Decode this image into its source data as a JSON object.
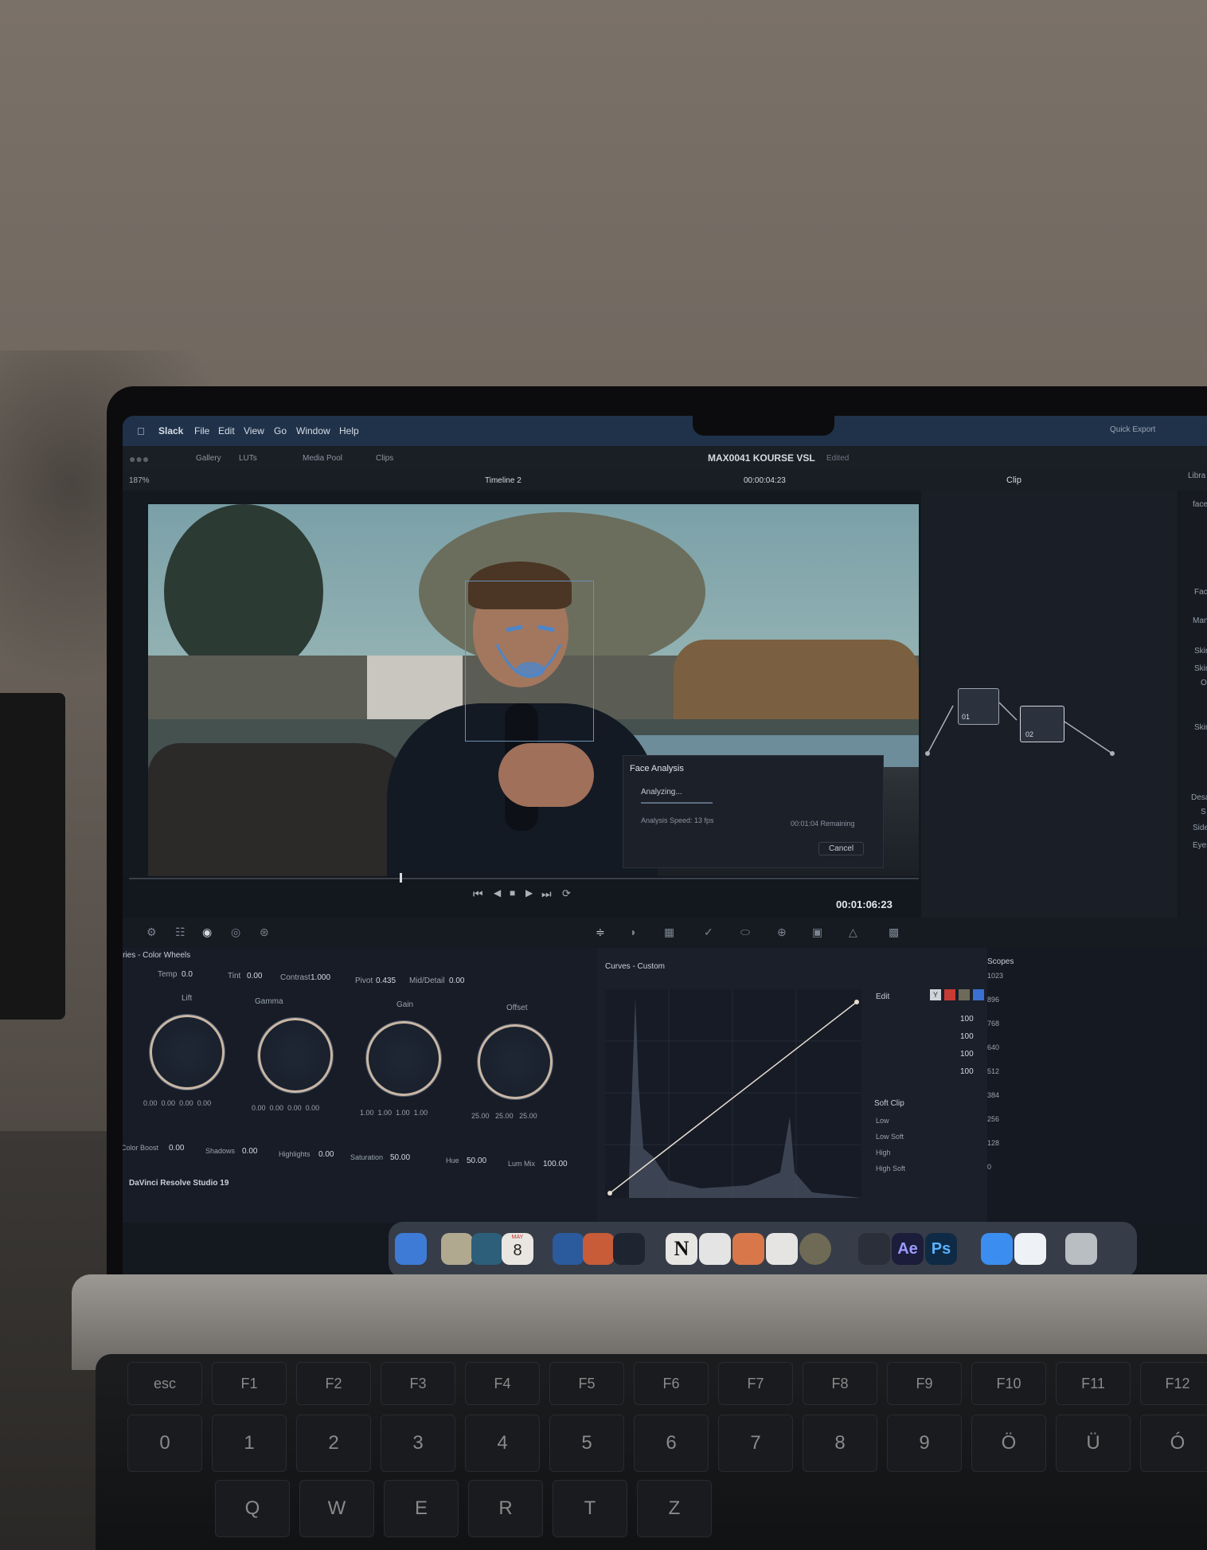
{
  "menubar": {
    "apple_icon": "apple-icon",
    "items": [
      "Slack",
      "File",
      "Edit",
      "View",
      "Go",
      "Window",
      "Help"
    ],
    "quick_export": "Quick Export"
  },
  "titlebar": {
    "tabs": [
      "Gallery",
      "LUTs",
      "Media Pool",
      "Clips"
    ],
    "project": "MAX0041 KOURSE VSL",
    "status": "Edited"
  },
  "viewer_toolbar": {
    "zoom": "187%",
    "timeline": "Timeline 2",
    "timecode": "00:00:04:23",
    "mode": "Clip"
  },
  "right_edge": [
    "Libra",
    "face",
    "Fac",
    "Manu",
    "Skin",
    "Skin",
    "O",
    "Skin",
    "Desat",
    "S",
    "Side",
    "Eyes"
  ],
  "nodes": [
    "01",
    "02"
  ],
  "face_analysis": {
    "title": "Face Analysis",
    "status": "Analyzing...",
    "speed": "Analysis Speed: 13 fps",
    "remaining": "00:01:04 Remaining",
    "cancel": "Cancel"
  },
  "transport": {
    "timecode": "00:01:06:23"
  },
  "primaries": {
    "title": "Primaries - Color Wheels",
    "temp_label": "Temp",
    "temp": "0.0",
    "tint_label": "Tint",
    "tint": "0.00",
    "contrast_label": "Contrast",
    "contrast": "1.000",
    "pivot_label": "Pivot",
    "pivot": "0.435",
    "middetail_label": "Mid/Detail",
    "middetail": "0.00",
    "wheels": [
      {
        "name": "Lift",
        "values": [
          "0.00",
          "0.00",
          "0.00",
          "0.00"
        ]
      },
      {
        "name": "Gamma",
        "values": [
          "0.00",
          "0.00",
          "0.00",
          "0.00"
        ]
      },
      {
        "name": "Gain",
        "values": [
          "1.00",
          "1.00",
          "1.00",
          "1.00"
        ]
      },
      {
        "name": "Offset",
        "values": [
          "25.00",
          "25.00",
          "25.00"
        ]
      }
    ],
    "colorboost_label": "Color Boost",
    "colorboost": "0.00",
    "shadows_label": "Shadows",
    "shadows": "0.00",
    "highlights_label": "Highlights",
    "highlights": "0.00",
    "saturation_label": "Saturation",
    "saturation": "50.00",
    "hue_label": "Hue",
    "hue": "50.00",
    "lummix_label": "Lum Mix",
    "lummix": "100.00",
    "app_name": "DaVinci Resolve Studio 19"
  },
  "curves": {
    "title": "Curves - Custom",
    "edit_label": "Edit",
    "channels": [
      "Y"
    ],
    "intensity": [
      "100",
      "100",
      "100",
      "100"
    ],
    "soft_clip": "Soft Clip",
    "soft_clip_rows": [
      "Low",
      "Low Soft",
      "High",
      "High Soft"
    ]
  },
  "scopes": {
    "title": "Scopes",
    "ticks": [
      "1023",
      "896",
      "768",
      "640",
      "512",
      "384",
      "256",
      "128",
      "0"
    ]
  },
  "dock": {
    "calendar_month": "MAY",
    "calendar_day": "8",
    "notion": "N",
    "ae": "Ae",
    "ps": "Ps"
  },
  "keyboard": {
    "fkeys": [
      "esc",
      "F1",
      "F2",
      "F3",
      "F4",
      "F5",
      "F6",
      "F7",
      "F8",
      "F9",
      "F10",
      "F11",
      "F12"
    ],
    "numkeys": [
      "0",
      "1",
      "2",
      "3",
      "4",
      "5",
      "6",
      "7",
      "8",
      "9",
      "Ö",
      "Ü",
      "Ó"
    ],
    "letters": [
      "Q",
      "W",
      "E",
      "R",
      "T",
      "Z"
    ]
  }
}
